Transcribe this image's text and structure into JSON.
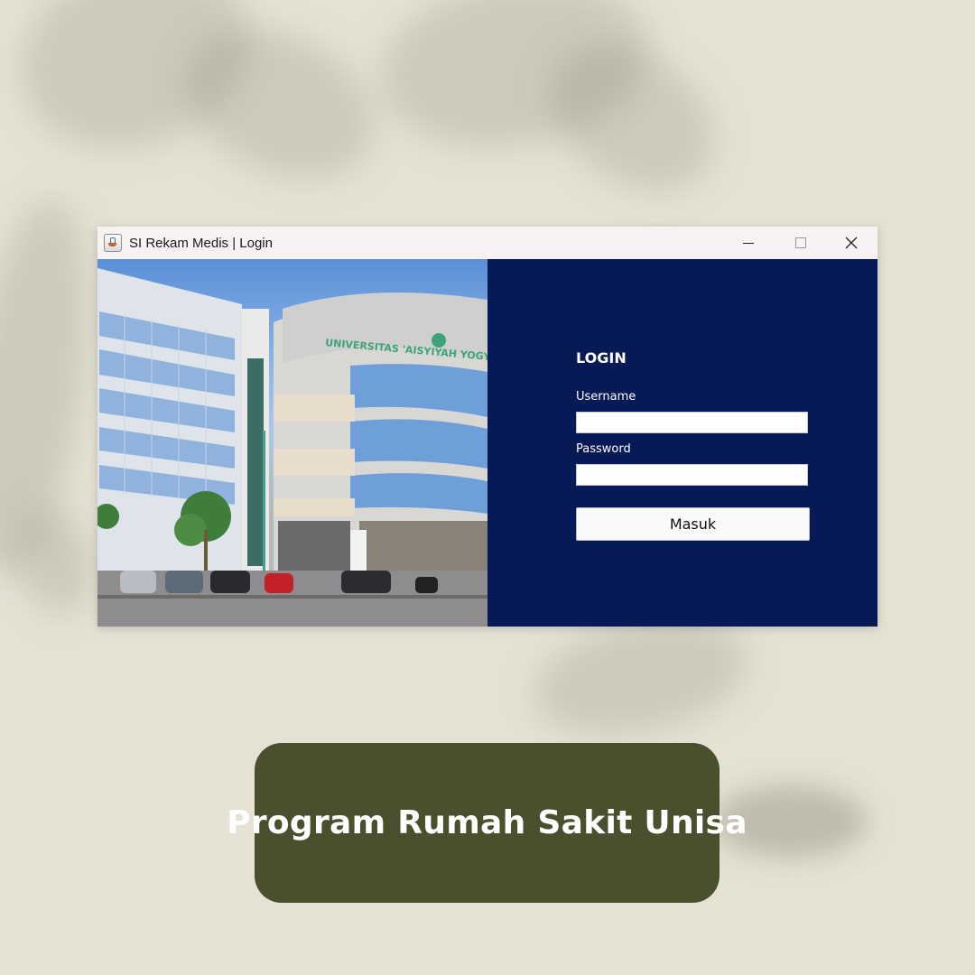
{
  "window": {
    "title": "SI Rekam Medis | Login",
    "icon": "java-coffee-cup-icon",
    "controls": [
      "minimize-icon",
      "maximize-icon",
      "close-icon"
    ]
  },
  "photo": {
    "sign_text": "UNIVERSITAS 'AISYIYAH YOGYA"
  },
  "login": {
    "title": "LOGIN",
    "username_label": "Username",
    "username_value": "",
    "password_label": "Password",
    "password_value": "",
    "submit_label": "Masuk"
  },
  "caption": {
    "text": "Program Rumah Sakit Unisa"
  },
  "colors": {
    "background": "#e5e2d4",
    "login_panel": "#081a55",
    "caption_box": "#4a4f2d",
    "campus_sign": "#3fa37a"
  }
}
